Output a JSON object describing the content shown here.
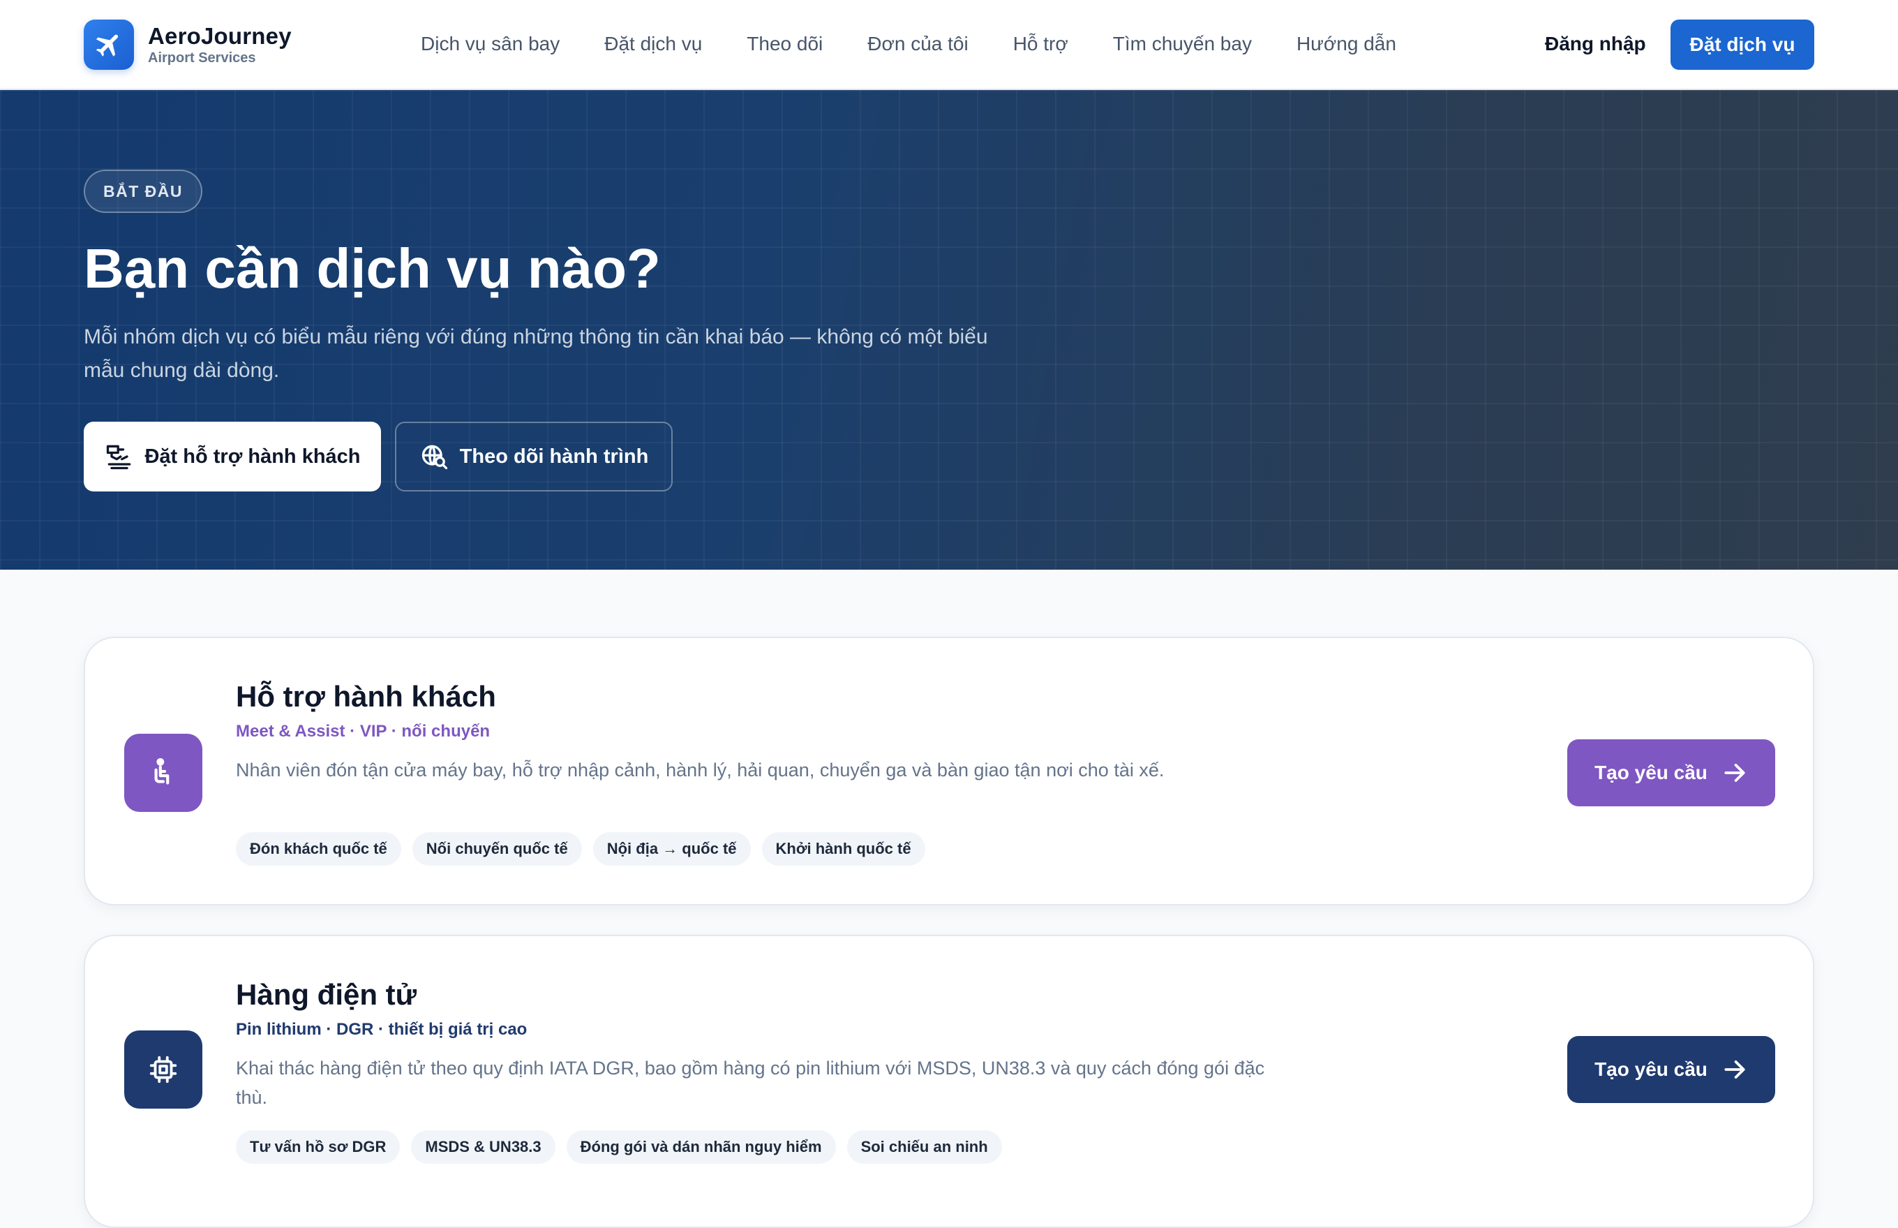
{
  "brand": {
    "name": "AeroJourney",
    "subtitle": "Airport Services",
    "logo_icon": "plane-icon",
    "accent": "#1b66d0"
  },
  "nav": {
    "items": [
      {
        "label": "Dịch vụ sân bay"
      },
      {
        "label": "Đặt dịch vụ"
      },
      {
        "label": "Theo dõi"
      },
      {
        "label": "Đơn của tôi"
      },
      {
        "label": "Hỗ trợ"
      },
      {
        "label": "Tìm chuyến bay"
      },
      {
        "label": "Hướng dẫn"
      }
    ],
    "login_label": "Đăng nhập",
    "cta_label": "Đặt dịch vụ"
  },
  "hero": {
    "badge": "BẮT ĐẦU",
    "title": "Bạn cần dịch vụ nào?",
    "description": "Mỗi nhóm dịch vụ có biểu mẫu riêng với đúng những thông tin cần khai báo — không có một biểu mẫu chung dài dòng.",
    "primary_button": {
      "label": "Đặt hỗ trợ hành khách",
      "icon": "passenger-assist-icon"
    },
    "secondary_button": {
      "label": "Theo dõi hành trình",
      "icon": "globe-search-icon"
    }
  },
  "services": [
    {
      "title": "Hỗ trợ hành khách",
      "subtitle": "Meet & Assist · VIP · nối chuyến",
      "description": "Nhân viên đón tận cửa máy bay, hỗ trợ nhập cảnh, hành lý, hải quan, chuyển ga và bàn giao tận nơi cho tài xế.",
      "tags": [
        "Đón khách quốc tế",
        "Nối chuyến quốc tế",
        "Nội địa → quốc tế",
        "Khởi hành quốc tế"
      ],
      "button_label": "Tạo yêu cầu",
      "icon": "seated-person-icon",
      "color": "#7e57c2"
    },
    {
      "title": "Hàng điện tử",
      "subtitle": "Pin lithium · DGR · thiết bị giá trị cao",
      "description": "Khai thác hàng điện tử theo quy định IATA DGR, bao gồm hàng có pin lithium với MSDS, UN38.3 và quy cách đóng gói đặc thù.",
      "tags": [
        "Tư vấn hồ sơ DGR",
        "MSDS & UN38.3",
        "Đóng gói và dán nhãn nguy hiểm",
        "Soi chiếu an ninh"
      ],
      "button_label": "Tạo yêu cầu",
      "icon": "chip-icon",
      "color": "#1f3a6e"
    }
  ]
}
